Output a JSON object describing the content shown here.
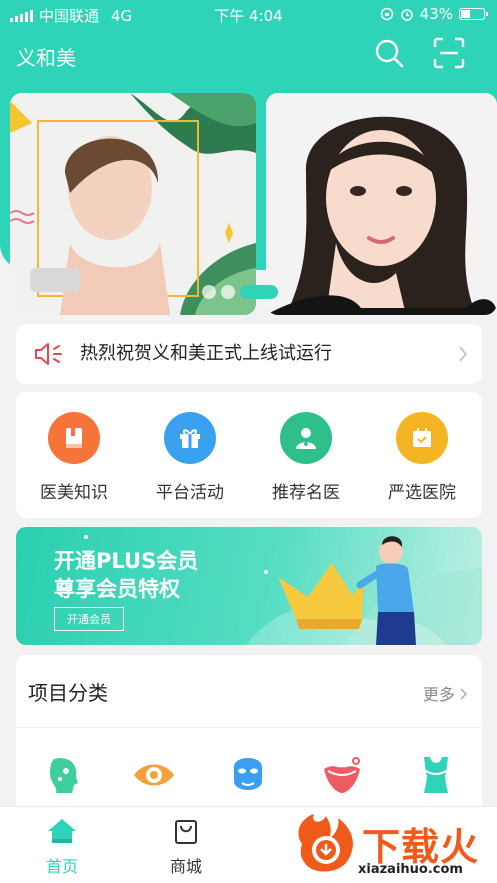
{
  "status_bar": {
    "carrier": "中国联通",
    "network": "4G",
    "time": "下午 4:04",
    "battery": "43%",
    "battery_level": 0.43
  },
  "header": {
    "title": "义和美"
  },
  "notice": {
    "text": "热烈祝贺义和美正式上线试运行"
  },
  "quick_menu": [
    {
      "label": "医美知识",
      "color": "#f5743a",
      "icon": "book-icon"
    },
    {
      "label": "平台活动",
      "color": "#3aa1f1",
      "icon": "gift-icon"
    },
    {
      "label": "推荐名医",
      "color": "#2fbf8a",
      "icon": "doctor-icon"
    },
    {
      "label": "严选医院",
      "color": "#f4b424",
      "icon": "calendar-icon"
    }
  ],
  "plus_banner": {
    "line1": "开通PLUS会员",
    "line2": "尊享会员特权",
    "button": "开通会员"
  },
  "category": {
    "title": "项目分类",
    "more": "更多"
  },
  "tabbar": [
    {
      "label": "首页",
      "active": true,
      "icon": "home-icon"
    },
    {
      "label": "商城",
      "active": false,
      "icon": "shop-bag-icon"
    }
  ],
  "watermark": {
    "text": "下载火",
    "domain": "xiazaihuo.com"
  },
  "colors": {
    "brand": "#2fd3b8",
    "notice_icon": "#e5494e"
  }
}
